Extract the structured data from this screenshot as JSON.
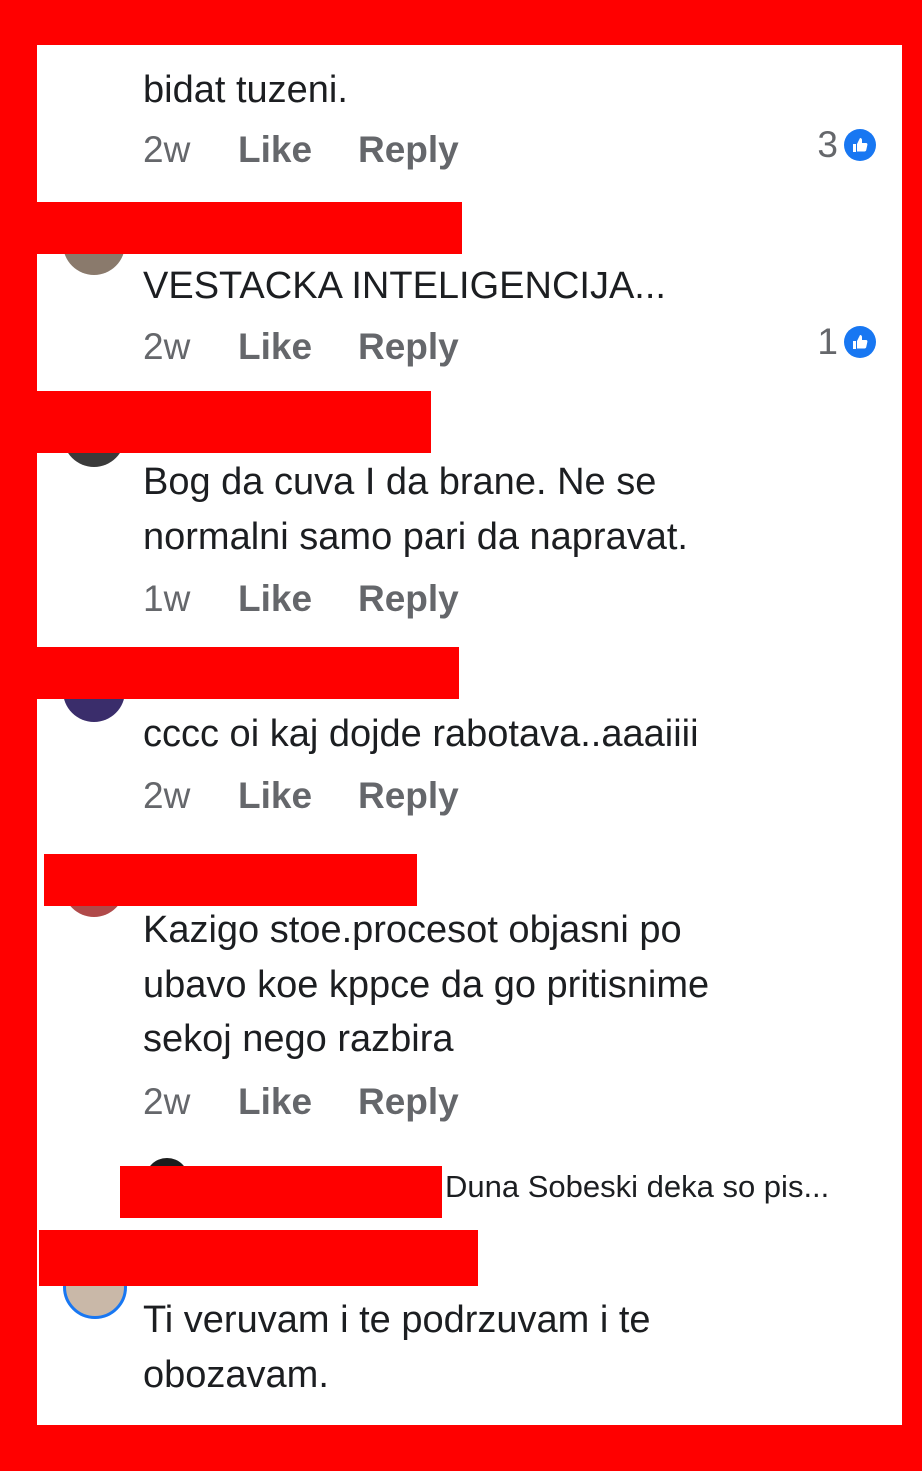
{
  "colors": {
    "frame": "#ff0000",
    "panel": "#ffffff",
    "text": "#1c1e21",
    "meta": "#65676b",
    "like_blue": "#1877f2"
  },
  "comments": [
    {
      "text_lines": [
        "bidat tuzeni."
      ],
      "time": "2w",
      "like": "Like",
      "reply": "Reply",
      "reactions": "3"
    },
    {
      "text_lines": [
        "VESTACKA INTELIGENCIJA..."
      ],
      "time": "2w",
      "like": "Like",
      "reply": "Reply",
      "reactions": "1"
    },
    {
      "text_lines": [
        "Bog da cuva I da brane. Ne se",
        "normalni samo pari da napravat."
      ],
      "time": "1w",
      "like": "Like",
      "reply": "Reply"
    },
    {
      "text_lines": [
        "cccc oi kaj dojde rabotava..aaaiiii"
      ],
      "time": "2w",
      "like": "Like",
      "reply": "Reply"
    },
    {
      "text_lines": [
        "Kazigo stoe.procesot  objasni po",
        "ubavo koe kppce da go pritisnime",
        "sekoj nego razbira"
      ],
      "time": "2w",
      "like": "Like",
      "reply": "Reply"
    },
    {
      "text_lines": [
        "Ti veruvam i te podrzuvam i te",
        "obozavam."
      ]
    }
  ],
  "reply_preview": "Duna Sobeski deka so pis...",
  "icons": {
    "like_reaction": "thumbs-up-icon",
    "avatar": "avatar-icon"
  }
}
